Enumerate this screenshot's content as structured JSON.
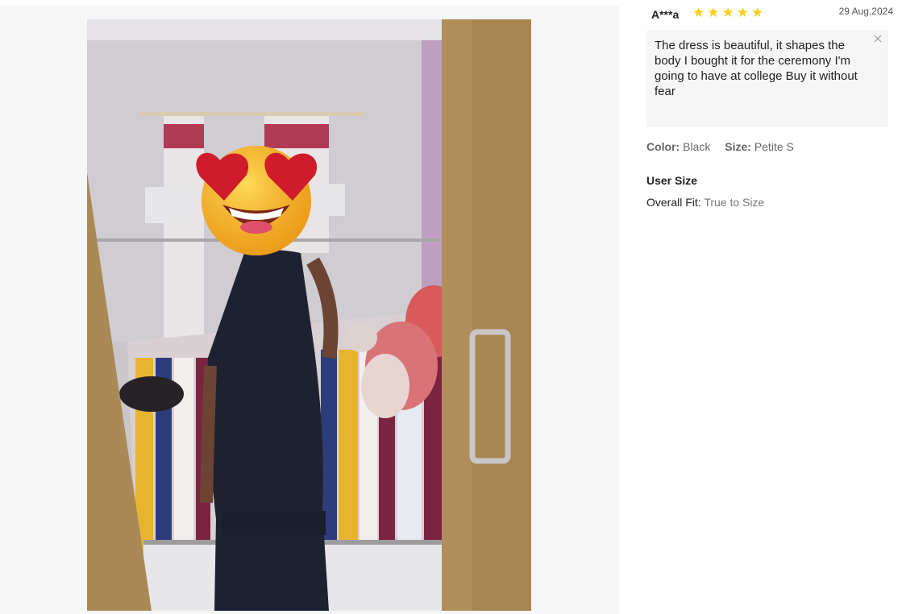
{
  "review": {
    "reviewer": "A***a",
    "rating": 5,
    "rating_max": 5,
    "date": "29 Aug,2024",
    "text": "The dress is beautiful, it shapes the body I bought it for the ceremony I'm going to have at college Buy it without fear"
  },
  "attributes": {
    "color_label": "Color:",
    "color_value": "Black",
    "size_label": "Size:",
    "size_value": "Petite S"
  },
  "user_size": {
    "title": "User Size",
    "fit_label": "Overall Fit:",
    "fit_value": "True to Size"
  },
  "colors": {
    "star": "#facf19",
    "review_box_bg": "#f6f6f6",
    "media_bg": "#f6f6f6"
  },
  "icons": {
    "star": "star-icon",
    "close": "close-icon"
  }
}
